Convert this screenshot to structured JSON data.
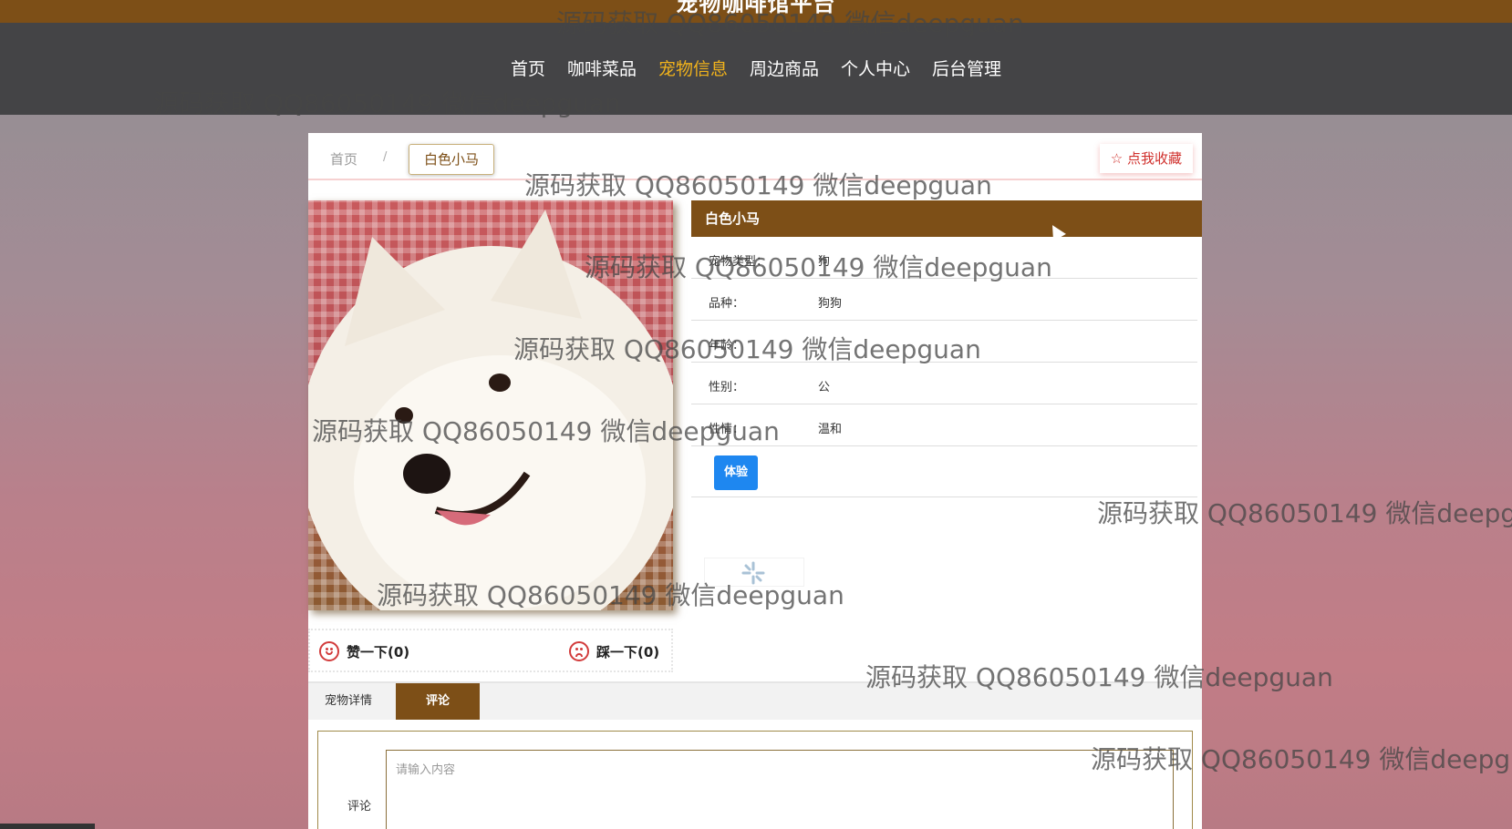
{
  "site": {
    "title": "宠物咖啡馆平台"
  },
  "nav": {
    "items": [
      {
        "label": "首页",
        "active": false
      },
      {
        "label": "咖啡菜品",
        "active": false
      },
      {
        "label": "宠物信息",
        "active": true
      },
      {
        "label": "周边商品",
        "active": false
      },
      {
        "label": "个人中心",
        "active": false
      },
      {
        "label": "后台管理",
        "active": false
      }
    ]
  },
  "breadcrumb": {
    "home": "首页",
    "separator": "/",
    "current": "白色小马"
  },
  "favorite": {
    "label": "☆ 点我收藏"
  },
  "pet": {
    "name": "白色小马",
    "fields": [
      {
        "label": "宠物类型：",
        "value": "狗"
      },
      {
        "label": "品种：",
        "value": "狗狗"
      },
      {
        "label": "年龄：",
        "value": ""
      },
      {
        "label": "性别：",
        "value": "公"
      },
      {
        "label": "性情：",
        "value": "温和"
      }
    ],
    "action_label": "体验"
  },
  "votes": {
    "like": "赞一下(0)",
    "dislike": "踩一下(0)"
  },
  "tabs": [
    {
      "label": "宠物详情"
    },
    {
      "label": "评论"
    }
  ],
  "comment": {
    "label": "评论",
    "placeholder": "请输入内容"
  },
  "watermark": "源码获取 QQ86050149 微信deepguan",
  "colors": {
    "brand": "#7d4f17",
    "nav_bg": "#444446",
    "active_nav": "#f0b21c",
    "primary_button": "#1e87f0",
    "favorite": "#d0312d"
  }
}
